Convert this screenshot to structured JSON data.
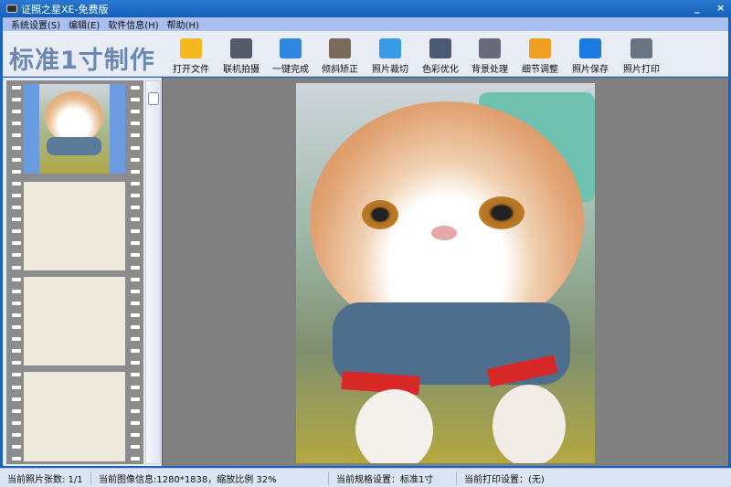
{
  "window": {
    "title": "证照之星XE-免费版",
    "minimize": "_",
    "close": "×"
  },
  "menu": [
    "系统设置(S)",
    "编辑(E)",
    "软件信息(H)",
    "帮助(H)"
  ],
  "brand": "标准1寸制作",
  "toolbar": [
    {
      "label": "打开文件",
      "icon": "folder-icon",
      "color": "#f5b820"
    },
    {
      "label": "联机拍摄",
      "icon": "camera-icon",
      "color": "#555a66"
    },
    {
      "label": "一键完成",
      "icon": "one-click-icon",
      "color": "#2e86de"
    },
    {
      "label": "倾斜矫正",
      "icon": "tilt-correct-icon",
      "color": "#7a6a5a"
    },
    {
      "label": "照片裁切",
      "icon": "crop-icon",
      "color": "#3a9ae8"
    },
    {
      "label": "色彩优化",
      "icon": "color-optimize-icon",
      "color": "#4a5a70"
    },
    {
      "label": "背景处理",
      "icon": "background-icon",
      "color": "#6a6a78"
    },
    {
      "label": "细节调整",
      "icon": "detail-adjust-icon",
      "color": "#f0a020"
    },
    {
      "label": "照片保存",
      "icon": "save-icon",
      "color": "#1a7ae0"
    },
    {
      "label": "照片打印",
      "icon": "printer-icon",
      "color": "#6a7480"
    }
  ],
  "status": {
    "count": "当前照片张数: 1/1",
    "image_info": "当前图像信息:1280*1838，缩放比例 32%",
    "spec": "当前规格设置：标准1寸",
    "print": "当前打印设置：(无)"
  }
}
